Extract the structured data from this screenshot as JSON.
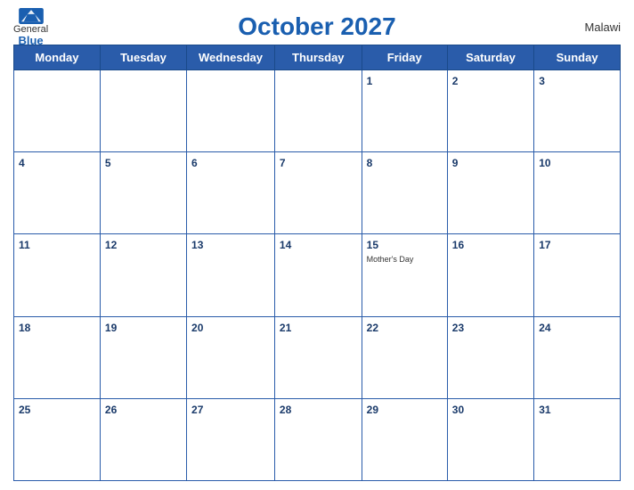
{
  "header": {
    "title": "October 2027",
    "country": "Malawi",
    "logo_general": "General",
    "logo_blue": "Blue"
  },
  "weekdays": [
    "Monday",
    "Tuesday",
    "Wednesday",
    "Thursday",
    "Friday",
    "Saturday",
    "Sunday"
  ],
  "weeks": [
    [
      {
        "day": "",
        "empty": true
      },
      {
        "day": "",
        "empty": true
      },
      {
        "day": "",
        "empty": true
      },
      {
        "day": "",
        "empty": true
      },
      {
        "day": "1",
        "event": ""
      },
      {
        "day": "2",
        "event": ""
      },
      {
        "day": "3",
        "event": ""
      }
    ],
    [
      {
        "day": "4",
        "event": ""
      },
      {
        "day": "5",
        "event": ""
      },
      {
        "day": "6",
        "event": ""
      },
      {
        "day": "7",
        "event": ""
      },
      {
        "day": "8",
        "event": ""
      },
      {
        "day": "9",
        "event": ""
      },
      {
        "day": "10",
        "event": ""
      }
    ],
    [
      {
        "day": "11",
        "event": ""
      },
      {
        "day": "12",
        "event": ""
      },
      {
        "day": "13",
        "event": ""
      },
      {
        "day": "14",
        "event": ""
      },
      {
        "day": "15",
        "event": "Mother's Day"
      },
      {
        "day": "16",
        "event": ""
      },
      {
        "day": "17",
        "event": ""
      }
    ],
    [
      {
        "day": "18",
        "event": ""
      },
      {
        "day": "19",
        "event": ""
      },
      {
        "day": "20",
        "event": ""
      },
      {
        "day": "21",
        "event": ""
      },
      {
        "day": "22",
        "event": ""
      },
      {
        "day": "23",
        "event": ""
      },
      {
        "day": "24",
        "event": ""
      }
    ],
    [
      {
        "day": "25",
        "event": ""
      },
      {
        "day": "26",
        "event": ""
      },
      {
        "day": "27",
        "event": ""
      },
      {
        "day": "28",
        "event": ""
      },
      {
        "day": "29",
        "event": ""
      },
      {
        "day": "30",
        "event": ""
      },
      {
        "day": "31",
        "event": ""
      }
    ]
  ]
}
